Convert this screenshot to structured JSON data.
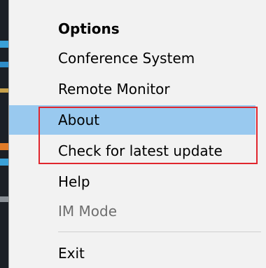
{
  "menu": {
    "items": [
      {
        "label": "Options",
        "style": "bold"
      },
      {
        "label": "Conference System",
        "style": "normal"
      },
      {
        "label": "Remote Monitor",
        "style": "normal"
      },
      {
        "label": "About",
        "style": "highlighted"
      },
      {
        "label": "Check for latest update",
        "style": "normal"
      },
      {
        "label": "Help",
        "style": "normal"
      },
      {
        "label": "IM Mode",
        "style": "disabled"
      },
      {
        "label": "Exit",
        "style": "normal"
      }
    ]
  },
  "colors": {
    "menu_background": "#f2f2f2",
    "highlight": "#99c9ef",
    "annotation_border": "#e0262e",
    "disabled_text": "#6d6d6d",
    "desktop_edge": "#1b1f26"
  }
}
